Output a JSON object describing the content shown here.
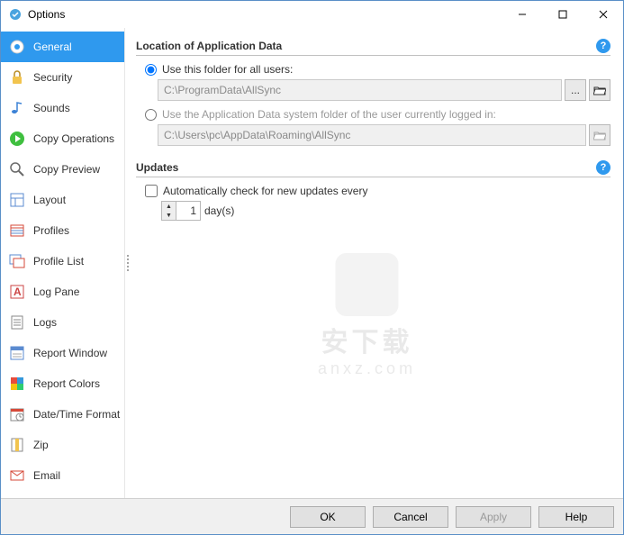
{
  "window": {
    "title": "Options"
  },
  "sidebar": {
    "items": [
      {
        "label": "General"
      },
      {
        "label": "Security"
      },
      {
        "label": "Sounds"
      },
      {
        "label": "Copy Operations"
      },
      {
        "label": "Copy Preview"
      },
      {
        "label": "Layout"
      },
      {
        "label": "Profiles"
      },
      {
        "label": "Profile List"
      },
      {
        "label": "Log Pane"
      },
      {
        "label": "Logs"
      },
      {
        "label": "Report Window"
      },
      {
        "label": "Report Colors"
      },
      {
        "label": "Date/Time Format"
      },
      {
        "label": "Zip"
      },
      {
        "label": "Email"
      }
    ],
    "selected_index": 0
  },
  "sections": {
    "location": {
      "title": "Location of Application Data",
      "radio1": "Use this folder for all users:",
      "path1": "C:\\ProgramData\\AllSync",
      "ellipsis": "...",
      "radio2": "Use the Application Data system folder of the user currently logged in:",
      "path2": "C:\\Users\\pc\\AppData\\Roaming\\AllSync",
      "help": "?"
    },
    "updates": {
      "title": "Updates",
      "check_label": "Automatically check for new updates every",
      "interval_value": "1",
      "interval_unit": "day(s)",
      "help": "?"
    }
  },
  "footer": {
    "ok": "OK",
    "cancel": "Cancel",
    "apply": "Apply",
    "help": "Help"
  },
  "watermark": {
    "line1": "安下载",
    "line2": "anxz.com"
  }
}
